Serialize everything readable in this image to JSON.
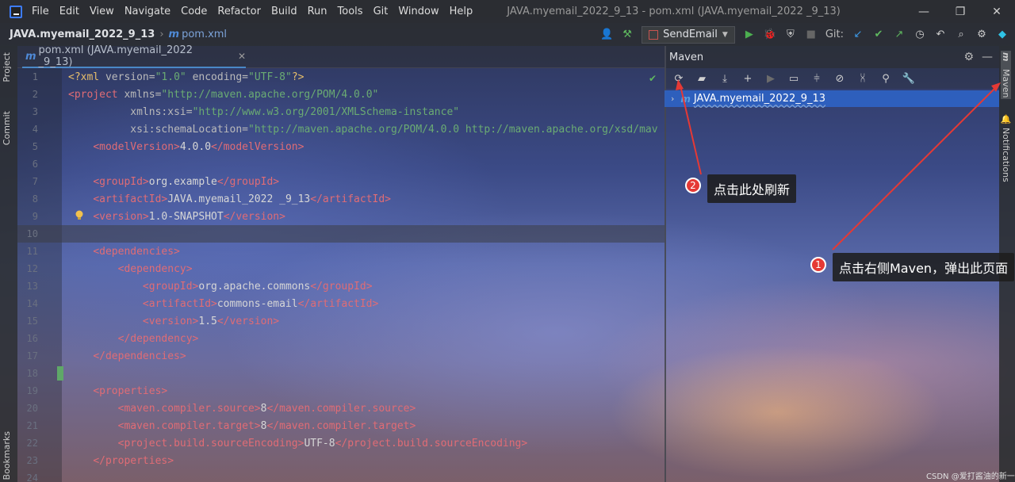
{
  "menubar": {
    "items": [
      "File",
      "Edit",
      "View",
      "Navigate",
      "Code",
      "Refactor",
      "Build",
      "Run",
      "Tools",
      "Git",
      "Window",
      "Help"
    ],
    "window_title": "JAVA.myemail_2022_9_13 - pom.xml (JAVA.myemail_2022 _9_13)"
  },
  "navbar": {
    "project": "JAVA.myemail_2022_9_13",
    "file": "pom.xml",
    "run_config": "SendEmail",
    "git_label": "Git:"
  },
  "left_strip": {
    "project": "Project",
    "commit": "Commit",
    "bookmarks": "Bookmarks"
  },
  "right_strip": {
    "maven": "Maven",
    "notifications": "Notifications"
  },
  "editor": {
    "tab_label": "pom.xml (JAVA.myemail_2022 _9_13)",
    "lines": [
      {
        "n": "1"
      },
      {
        "n": "2"
      },
      {
        "n": "3"
      },
      {
        "n": "4"
      },
      {
        "n": "5"
      },
      {
        "n": "6"
      },
      {
        "n": "7"
      },
      {
        "n": "8"
      },
      {
        "n": "9"
      },
      {
        "n": "10"
      },
      {
        "n": "11"
      },
      {
        "n": "12"
      },
      {
        "n": "13"
      },
      {
        "n": "14"
      },
      {
        "n": "15"
      },
      {
        "n": "16"
      },
      {
        "n": "17"
      },
      {
        "n": "18"
      },
      {
        "n": "19"
      },
      {
        "n": "20"
      },
      {
        "n": "21"
      },
      {
        "n": "22"
      },
      {
        "n": "23"
      },
      {
        "n": "24"
      }
    ],
    "code": {
      "l1_a": "<?xml ",
      "l1_b": "version=",
      "l1_c": "\"1.0\" ",
      "l1_d": "encoding=",
      "l1_e": "\"UTF-8\"",
      "l1_f": "?>",
      "l2_a": "<project ",
      "l2_b": "xmlns=",
      "l2_c": "\"http://maven.apache.org/POM/4.0.0\"",
      "l3_a": "xmlns:xsi=",
      "l3_b": "\"http://www.w3.org/2001/XMLSchema-instance\"",
      "l4_a": "xsi:schemaLocation=",
      "l4_b": "\"http://maven.apache.org/POM/4.0.0 http://maven.apache.org/xsd/mav",
      "l5_a": "<modelVersion>",
      "l5_b": "4.0.0",
      "l5_c": "</modelVersion>",
      "l7_a": "<groupId>",
      "l7_b": "org.example",
      "l7_c": "</groupId>",
      "l8_a": "<artifactId>",
      "l8_b": "JAVA.myemail_2022 _9_13",
      "l8_c": "</artifactId>",
      "l9_a": "<version>",
      "l9_b": "1.0-SNAPSHOT",
      "l9_c": "</version>",
      "l11": "<dependencies>",
      "l12": "<dependency>",
      "l13_a": "<groupId>",
      "l13_b": "org.apache.commons",
      "l13_c": "</groupId>",
      "l14_a": "<artifactId>",
      "l14_b": "commons-email",
      "l14_c": "</artifactId>",
      "l15_a": "<version>",
      "l15_b": "1.5",
      "l15_c": "</version>",
      "l16": "</dependency>",
      "l17": "</dependencies>",
      "l19": "<properties>",
      "l20_a": "<maven.compiler.source>",
      "l20_b": "8",
      "l20_c": "</maven.compiler.source>",
      "l21_a": "<maven.compiler.target>",
      "l21_b": "8",
      "l21_c": "</maven.compiler.target>",
      "l22_a": "<project.build.sourceEncoding>",
      "l22_b": "UTF-8",
      "l22_c": "</project.build.sourceEncoding>",
      "l23": "</properties>"
    }
  },
  "maven": {
    "title": "Maven",
    "tree_item": "JAVA.myemail_2022_9_13"
  },
  "annotations": {
    "callout_1": {
      "badge": "1",
      "text": "点击右侧Maven，弹出此页面"
    },
    "callout_2": {
      "badge": "2",
      "text": "点击此处刷新"
    }
  },
  "watermark": "CSDN @爱打酱油的新一",
  "colors": {
    "accent": "#2e65ca",
    "annotation": "#e53935"
  }
}
